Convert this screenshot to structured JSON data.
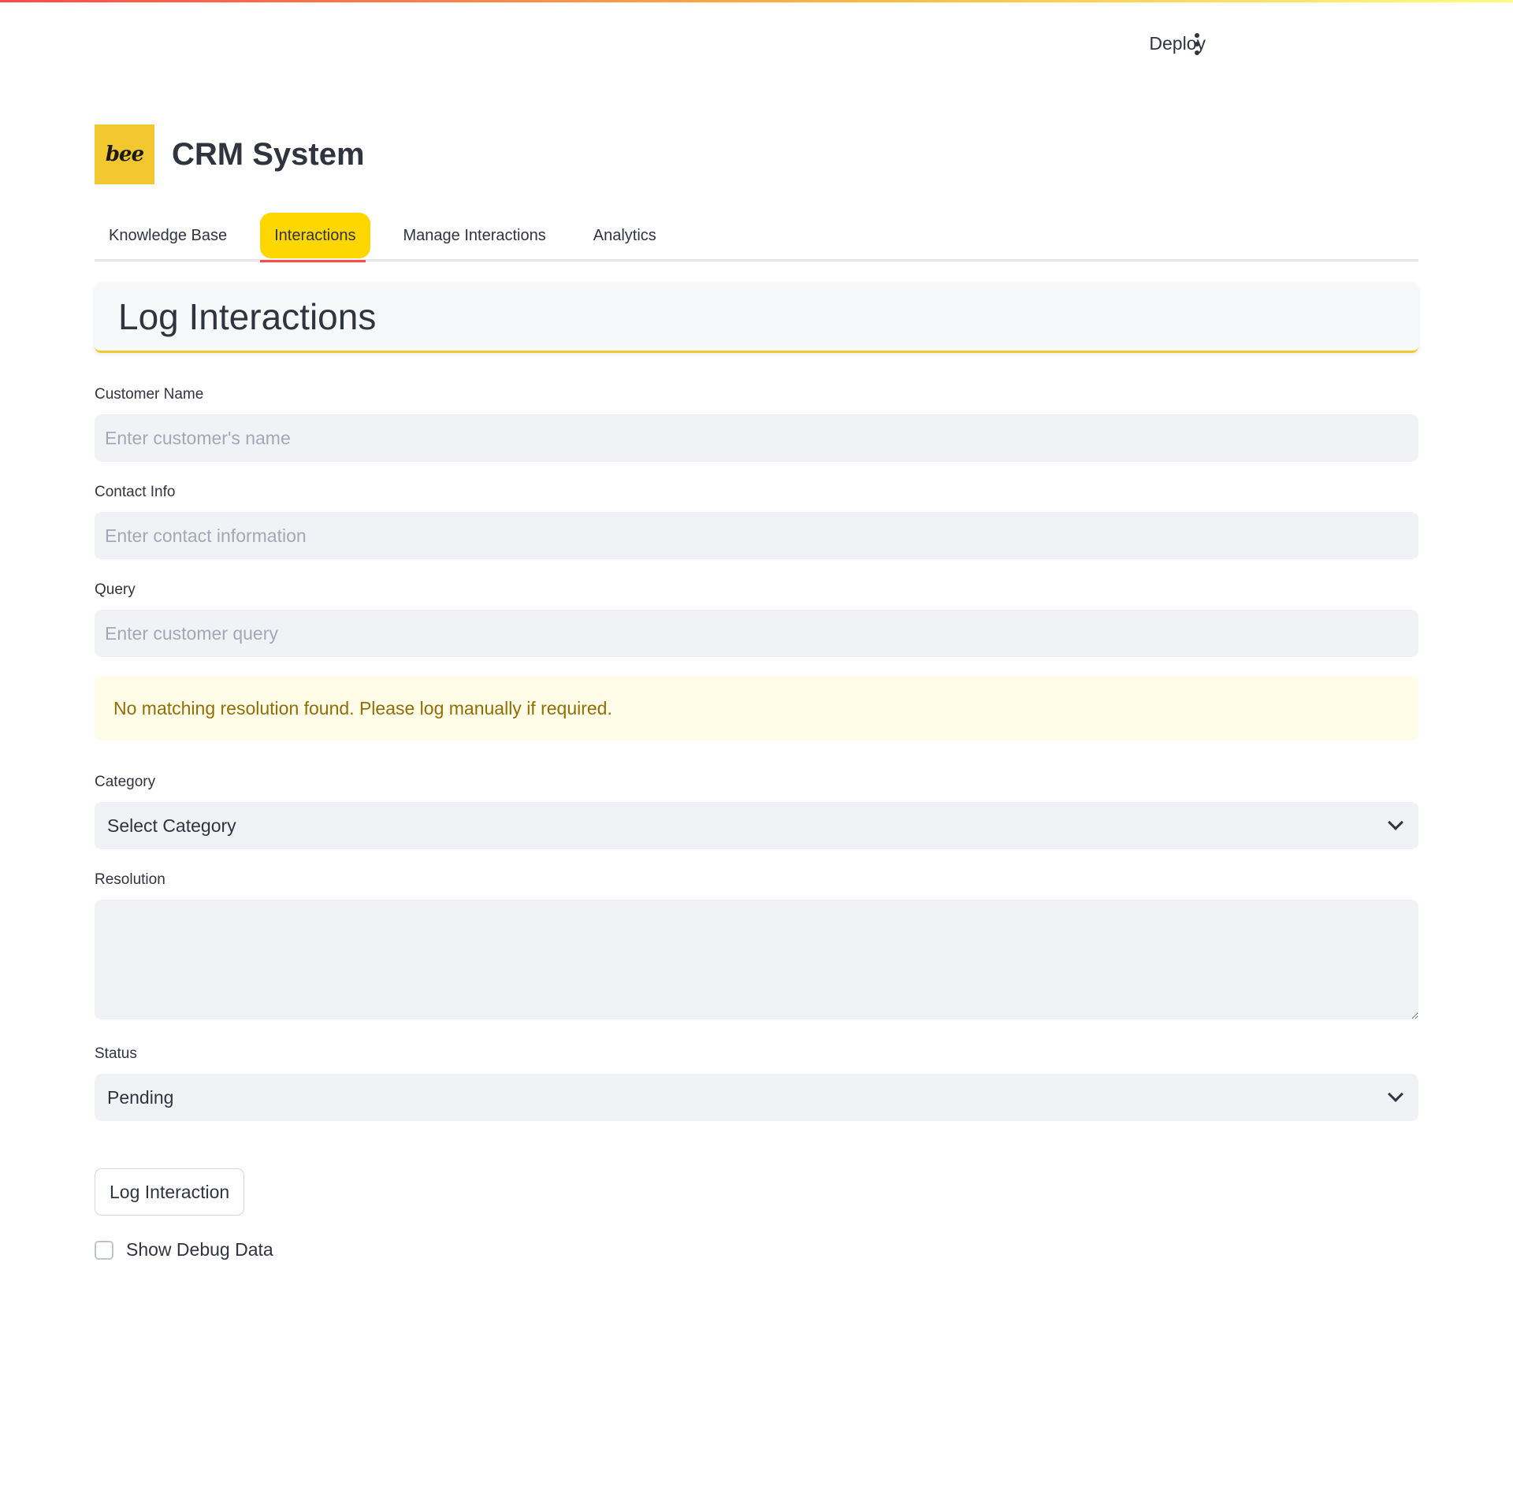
{
  "header": {
    "deploy_label": "Deploy",
    "menu_icon": "vertical-dots-icon"
  },
  "brand": {
    "logo_text": "bee",
    "logo_color": "#f2c730",
    "title": "CRM System"
  },
  "tabs": [
    {
      "label": "Knowledge Base",
      "active": false
    },
    {
      "label": "Interactions",
      "active": true
    },
    {
      "label": "Manage Interactions",
      "active": false
    },
    {
      "label": "Analytics",
      "active": false
    }
  ],
  "section": {
    "title": "Log Interactions"
  },
  "form": {
    "customer_name": {
      "label": "Customer Name",
      "value": "",
      "placeholder": "Enter customer's name"
    },
    "contact_info": {
      "label": "Contact Info",
      "value": "",
      "placeholder": "Enter contact information"
    },
    "query": {
      "label": "Query",
      "value": "",
      "placeholder": "Enter customer query"
    },
    "warning": "No matching resolution found. Please log manually if required.",
    "category": {
      "label": "Category",
      "selected": "Select Category"
    },
    "resolution": {
      "label": "Resolution",
      "value": ""
    },
    "status": {
      "label": "Status",
      "selected": "Pending"
    },
    "submit_label": "Log Interaction",
    "debug_checkbox": {
      "label": "Show Debug Data",
      "checked": false
    }
  },
  "colors": {
    "accent_yellow": "#ffd700",
    "active_underline": "#ff4b4b",
    "warning_bg": "#fffce7",
    "warning_text": "#926c05"
  }
}
